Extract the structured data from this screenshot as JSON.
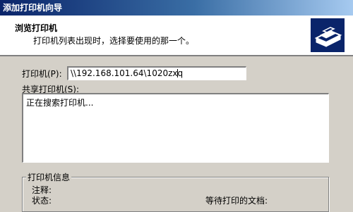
{
  "window": {
    "title": "添加打印机向导"
  },
  "header": {
    "title": "浏览打印机",
    "subtitle": "打印机列表出现时，选择要使用的那一个。",
    "icon": "printer-icon"
  },
  "printer_field": {
    "label": "打印机(P):",
    "value": "\\\\192.168.101.64\\1020zxq"
  },
  "shared_printers": {
    "label": "共享打印机(S):",
    "items": [
      "正在搜索打印机..."
    ]
  },
  "printer_info": {
    "title": "打印机信息",
    "comment_label": "注释:",
    "status_label": "状态:",
    "waiting_docs_label": "等待打印的文档:"
  }
}
